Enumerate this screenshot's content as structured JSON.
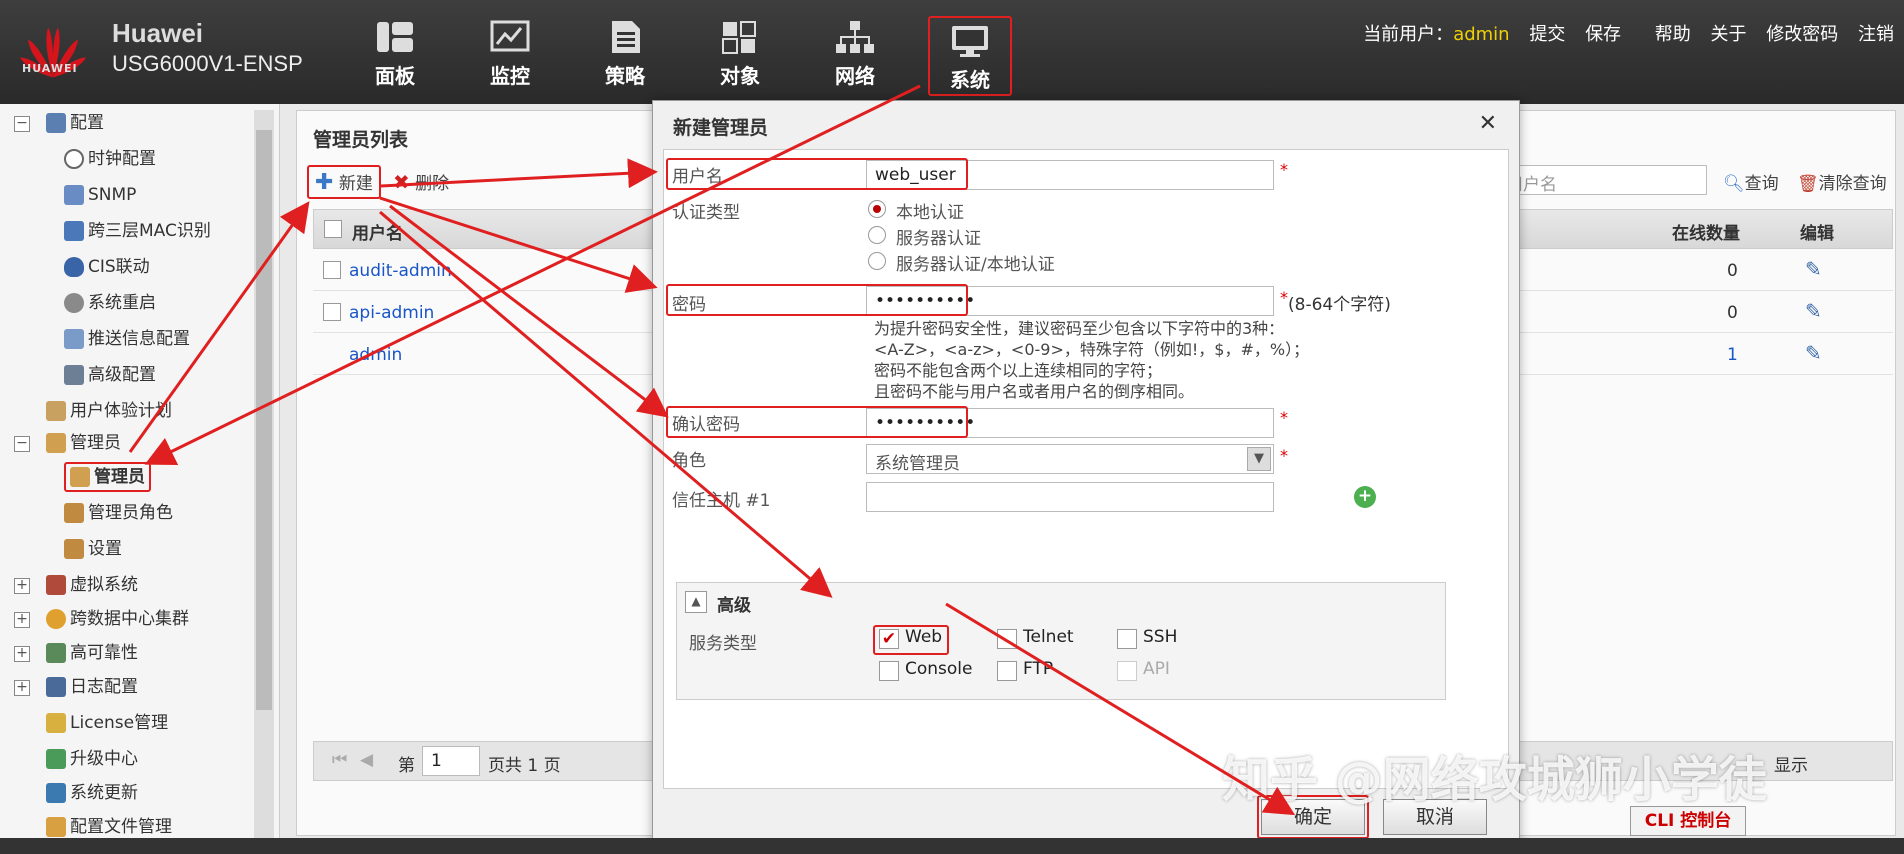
{
  "header": {
    "brand": "Huawei",
    "model": "USG6000V1-ENSP",
    "logo_text": "HUAWEI",
    "nav": [
      {
        "label": "面板",
        "icon": "dashboard-icon"
      },
      {
        "label": "监控",
        "icon": "monitor-icon"
      },
      {
        "label": "策略",
        "icon": "policy-icon"
      },
      {
        "label": "对象",
        "icon": "object-icon"
      },
      {
        "label": "网络",
        "icon": "network-icon"
      },
      {
        "label": "系统",
        "icon": "system-icon",
        "active": true
      }
    ],
    "current_user_label": "当前用户：",
    "current_user": "admin",
    "actions": [
      "提交",
      "保存",
      "帮助",
      "关于",
      "修改密码",
      "注销"
    ]
  },
  "sidebar": {
    "items": [
      {
        "label": "配置",
        "icon": "config-icon"
      },
      {
        "label": "时钟配置",
        "icon": "clock-icon"
      },
      {
        "label": "SNMP",
        "icon": "snmp-icon"
      },
      {
        "label": "跨三层MAC识别",
        "icon": "mac-icon"
      },
      {
        "label": "CIS联动",
        "icon": "cis-icon"
      },
      {
        "label": "系统重启",
        "icon": "restart-icon"
      },
      {
        "label": "推送信息配置",
        "icon": "push-icon"
      },
      {
        "label": "高级配置",
        "icon": "advanced-config-icon"
      },
      {
        "label": "用户体验计划",
        "icon": "user-experience-icon"
      },
      {
        "label": "管理员",
        "icon": "admin-group-icon"
      },
      {
        "label": "管理员",
        "icon": "admin-icon"
      },
      {
        "label": "管理员角色",
        "icon": "admin-role-icon"
      },
      {
        "label": "设置",
        "icon": "settings-icon"
      },
      {
        "label": "虚拟系统",
        "icon": "vsys-icon"
      },
      {
        "label": "跨数据中心集群",
        "icon": "cluster-icon"
      },
      {
        "label": "高可靠性",
        "icon": "ha-icon"
      },
      {
        "label": "日志配置",
        "icon": "log-icon"
      },
      {
        "label": "License管理",
        "icon": "license-icon"
      },
      {
        "label": "升级中心",
        "icon": "upgrade-icon"
      },
      {
        "label": "系统更新",
        "icon": "update-icon"
      },
      {
        "label": "配置文件管理",
        "icon": "config-file-icon"
      }
    ]
  },
  "main": {
    "title": "管理员列表",
    "new_label": "新建",
    "delete_label": "删除",
    "search_placeholder": "用户名",
    "query_label": "查询",
    "clear_query_label": "清除查询",
    "columns": [
      "用户名",
      "在线数量",
      "编辑"
    ],
    "rows": [
      {
        "username": "audit-admin",
        "online": "0"
      },
      {
        "username": "api-admin",
        "online": "0"
      },
      {
        "username": "admin",
        "online": "1"
      }
    ],
    "pager": {
      "page_prefix": "第",
      "page": "1",
      "total": "页共 1 页",
      "display_text": "显示"
    }
  },
  "dialog": {
    "title": "新建管理员",
    "username_label": "用户名",
    "username_value": "web_user",
    "auth_type_label": "认证类型",
    "auth_options": [
      "本地认证",
      "服务器认证",
      "服务器认证/本地认证"
    ],
    "password_label": "密码",
    "password_value": "••••••••••",
    "password_hint_suffix": "(8-64个字符)",
    "password_rules": [
      "为提升密码安全性，建议密码至少包含以下字符中的3种：",
      "<A-Z>，<a-z>，<0-9>，特殊字符（例如!，$，#，%）；",
      "密码不能包含两个以上连续相同的字符；",
      "且密码不能与用户名或者用户名的倒序相同。"
    ],
    "confirm_password_label": "确认密码",
    "confirm_password_value": "••••••••••",
    "role_label": "角色",
    "role_value": "系统管理员",
    "trusted_host_label": "信任主机 #1",
    "advanced_label": "高级",
    "service_type_label": "服务类型",
    "services": [
      "Web",
      "Telnet",
      "SSH",
      "Console",
      "FTP",
      "API"
    ],
    "ok_label": "确定",
    "cancel_label": "取消"
  },
  "watermark": "知乎 @网络攻城狮小学徒",
  "cli_label": "CLI 控制台",
  "colors": {
    "accent_red": "#e02020",
    "link_blue": "#1a55c8",
    "user_yellow": "#f0d000"
  }
}
